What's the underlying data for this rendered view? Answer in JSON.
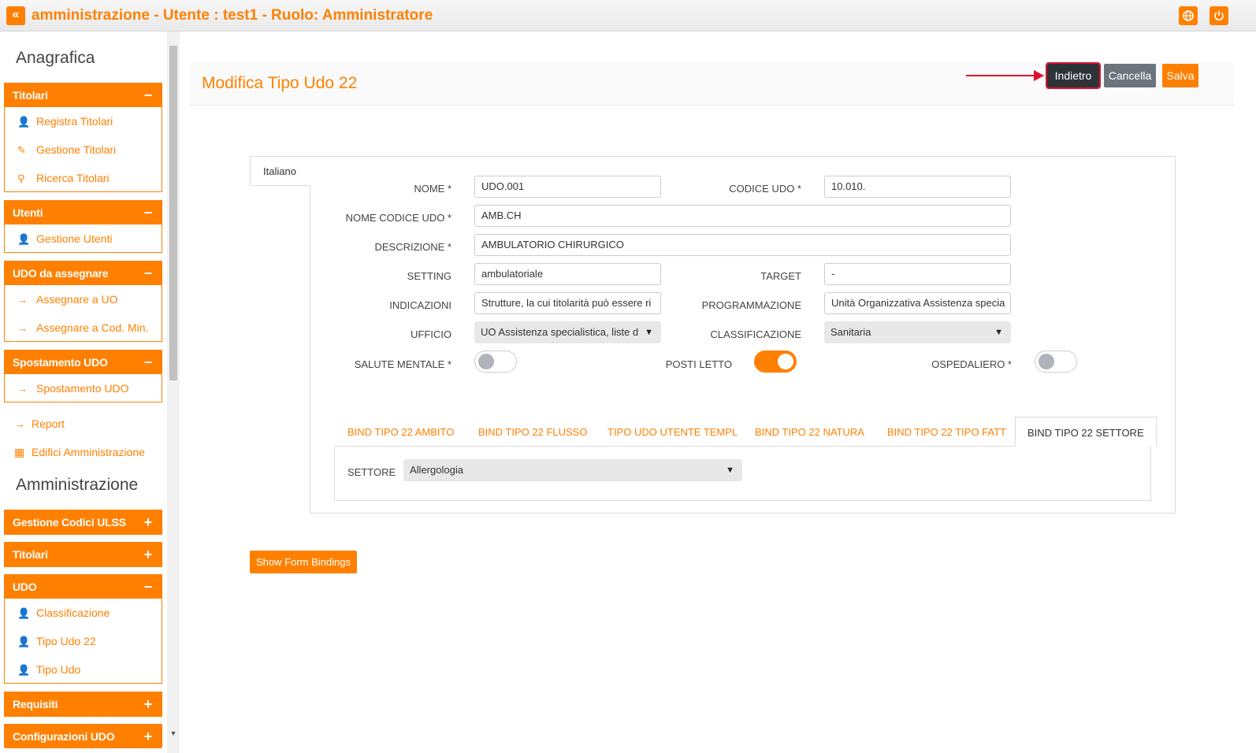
{
  "topbar": {
    "toggle_icon": "«",
    "title": "amministrazione - Utente : test1 - Ruolo: Amministratore",
    "globe_icon": "🌐",
    "power_icon": "⏻"
  },
  "sidebar": {
    "anagrafica_heading": "Anagrafica",
    "amministrazione_heading": "Amministrazione",
    "groups": {
      "titolari": {
        "label": "Titolari",
        "sign": "−",
        "items": [
          "Registra Titolari",
          "Gestione Titolari",
          "Ricerca Titolari"
        ]
      },
      "utenti": {
        "label": "Utenti",
        "sign": "−",
        "items": [
          "Gestione Utenti"
        ]
      },
      "udo_da_assegnare": {
        "label": "UDO da assegnare",
        "sign": "−",
        "items": [
          "Assegnare a UO",
          "Assegnare a Cod. Min."
        ]
      },
      "spostamento_udo": {
        "label": "Spostamento UDO",
        "sign": "−",
        "items": [
          "Spostamento UDO"
        ]
      },
      "gestione_codici_ulss": {
        "label": "Gestione Codici ULSS",
        "sign": "+"
      },
      "titolari2": {
        "label": "Titolari",
        "sign": "+"
      },
      "udo": {
        "label": "UDO",
        "sign": "−",
        "items": [
          "Classificazione",
          "Tipo Udo 22",
          "Tipo Udo"
        ]
      },
      "requisiti": {
        "label": "Requisiti",
        "sign": "+"
      },
      "configurazioni_udo": {
        "label": "Configurazioni UDO",
        "sign": "+"
      }
    },
    "links": {
      "report": "Report",
      "edifici": "Edifici Amministrazione"
    }
  },
  "main": {
    "title": "Modifica Tipo Udo 22",
    "buttons": {
      "back": "Indietro",
      "cancel": "Cancella",
      "save": "Salva"
    },
    "lang_tab": "Italiano",
    "form": {
      "nome": {
        "label": "NOME *",
        "value": "UDO.001"
      },
      "codice_udo": {
        "label": "CODICE UDO *",
        "value": "10.010."
      },
      "nome_codice_udo": {
        "label": "NOME CODICE UDO *",
        "value": "AMB.CH"
      },
      "descrizione": {
        "label": "DESCRIZIONE *",
        "value": "AMBULATORIO CHIRURGICO"
      },
      "setting": {
        "label": "SETTING",
        "value": "ambulatoriale"
      },
      "target": {
        "label": "TARGET",
        "value": "-"
      },
      "indicazioni": {
        "label": "INDICAZIONI",
        "value": "Strutture, la cui titolarità può essere ri"
      },
      "programmazione": {
        "label": "PROGRAMMAZIONE",
        "value": "Unità Organizzativa Assistenza specia"
      },
      "ufficio": {
        "label": "UFFICIO",
        "value": "UO Assistenza specialistica, liste d"
      },
      "classificazione": {
        "label": "CLASSIFICAZIONE",
        "value": "Sanitaria"
      },
      "salute_mentale": {
        "label": "SALUTE MENTALE *",
        "on": false
      },
      "posti_letto": {
        "label": "POSTI LETTO",
        "on": true
      },
      "ospedaliero": {
        "label": "OSPEDALIERO *",
        "on": false
      }
    },
    "tabs": [
      "BIND TIPO 22 AMBITO",
      "BIND TIPO 22 FLUSSO",
      "TIPO UDO UTENTE TEMPL",
      "BIND TIPO 22 NATURA",
      "BIND TIPO 22 TIPO FATT",
      "BIND TIPO 22 SETTORE"
    ],
    "active_tab": "BIND TIPO 22 SETTORE",
    "settore": {
      "label": "SETTORE",
      "value": "Allergologia"
    },
    "show_bindings": "Show Form Bindings"
  },
  "colors": {
    "accent": "#ff8000",
    "dark_button": "#2e3338",
    "grey_button": "#6c757d",
    "annotation_red": "#e0102f"
  },
  "caret_icon": "▼"
}
